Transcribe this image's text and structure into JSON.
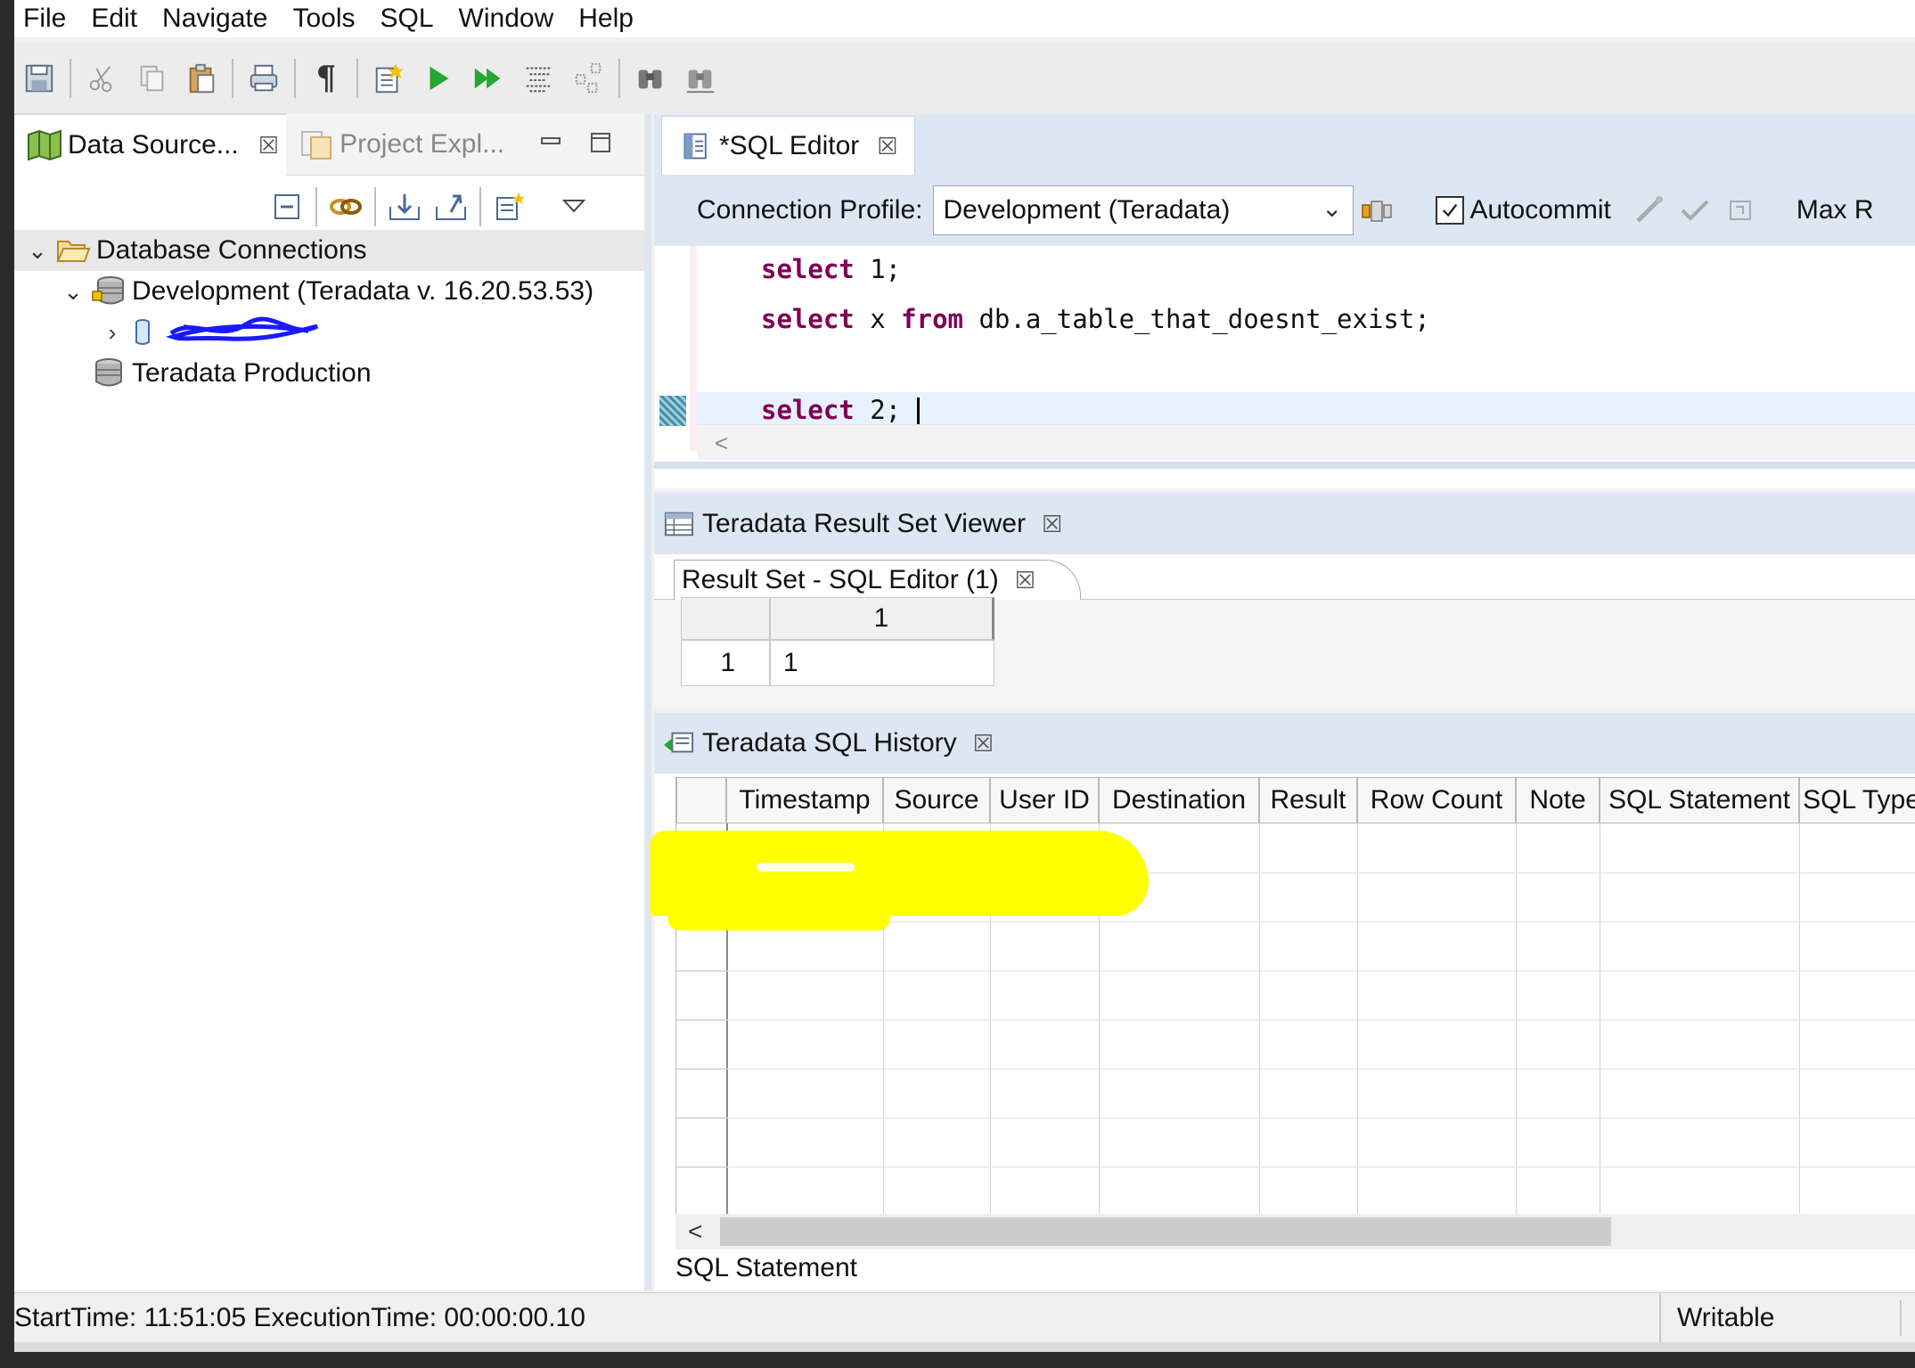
{
  "menubar": {
    "items": [
      "File",
      "Edit",
      "Navigate",
      "Tools",
      "SQL",
      "Window",
      "Help"
    ]
  },
  "toolbar": {
    "icons": [
      "save-icon",
      "cut-icon",
      "copy-icon",
      "paste-icon",
      "print-icon",
      "pilcrow-icon",
      "new-sql-icon",
      "run-icon",
      "run-all-icon",
      "explain-icon",
      "visual-explain-icon",
      "find-icon",
      "replace-icon"
    ],
    "pilcrow": "¶"
  },
  "left_panel": {
    "tabs": [
      {
        "label": "Data Source...",
        "close": "☒",
        "active": true
      },
      {
        "label": "Project Expl...",
        "active": false
      }
    ],
    "tree": {
      "root": "Database Connections",
      "children": [
        {
          "label": "Development (Teradata v. 16.20.53.53)",
          "expanded": true,
          "children": [
            {
              "label": "[redacted]"
            }
          ]
        },
        {
          "label": "Teradata Production"
        }
      ]
    }
  },
  "editor": {
    "tab_label": "*SQL Editor",
    "tab_close": "☒",
    "connection_label": "Connection Profile:",
    "connection_value": "Development (Teradata)",
    "autocommit_label": "Autocommit",
    "autocommit_checked": true,
    "max_label": "Max R",
    "lines": [
      {
        "kw": "select",
        "rest": " 1;"
      },
      {
        "kw": "select",
        "rest": " x ",
        "kw2": "from",
        "rest2": " db.a_table_that_doesnt_exist;"
      },
      {
        "kw": "select",
        "rest": " 2; "
      }
    ],
    "hscroll_arrow": "<"
  },
  "result_viewer": {
    "title": "Teradata Result Set Viewer",
    "close": "☒",
    "tab_label": "Result Set - SQL Editor (1)",
    "column_header": "1",
    "row_num": "1",
    "row_value": "1"
  },
  "history": {
    "title": "Teradata SQL History",
    "close": "☒",
    "columns": [
      "Timestamp",
      "Source",
      "User ID",
      "Destination",
      "Result",
      "Row Count",
      "Note",
      "SQL Statement",
      "SQL Type"
    ],
    "scroll_arrow": "<",
    "sql_statement_label": "SQL Statement"
  },
  "status": {
    "left": "StartTime: 11:51:05 ExecutionTime: 00:00:00.10",
    "right": "Writable"
  },
  "colors": {
    "keyword": "#7f0055",
    "highlight": "#ffff00",
    "scribble": "#1a1aff",
    "panel_header": "#dde7f3"
  }
}
